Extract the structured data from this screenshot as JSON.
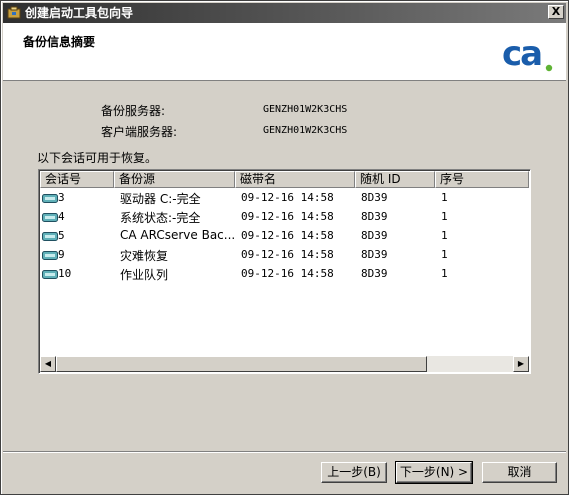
{
  "window": {
    "title": "创建启动工具包向导",
    "close_label": "X"
  },
  "header": {
    "heading": "备份信息摘要",
    "logo_text": "ca"
  },
  "info": {
    "backup_server_label": "备份服务器:",
    "backup_server_value": "GENZH01W2K3CHS",
    "client_server_label": "客户端服务器:",
    "client_server_value": "GENZH01W2K3CHS"
  },
  "sessions_caption": "以下会话可用于恢复。",
  "table": {
    "columns": [
      "会话号",
      "备份源",
      "磁带名",
      "随机 ID",
      "序号"
    ],
    "rows": [
      {
        "session": "3",
        "source": "驱动器 C:-完全",
        "tape": "09-12-16 14:58",
        "random_id": "8D39",
        "seq": "1"
      },
      {
        "session": "4",
        "source": "系统状态:-完全",
        "tape": "09-12-16 14:58",
        "random_id": "8D39",
        "seq": "1"
      },
      {
        "session": "5",
        "source": "CA ARCserve Bac...",
        "tape": "09-12-16 14:58",
        "random_id": "8D39",
        "seq": "1"
      },
      {
        "session": "9",
        "source": "灾难恢复",
        "tape": "09-12-16 14:58",
        "random_id": "8D39",
        "seq": "1"
      },
      {
        "session": "10",
        "source": "作业队列",
        "tape": "09-12-16 14:58",
        "random_id": "8D39",
        "seq": "1"
      }
    ]
  },
  "scrollbar": {
    "left_arrow": "◀",
    "right_arrow": "▶"
  },
  "buttons": {
    "back": "上一步(B)",
    "next": "下一步(N) >",
    "cancel": "取消"
  },
  "colors": {
    "logo_blue": "#1a5dab",
    "logo_green": "#5fb334",
    "title_bar": "#3c3c3c"
  }
}
